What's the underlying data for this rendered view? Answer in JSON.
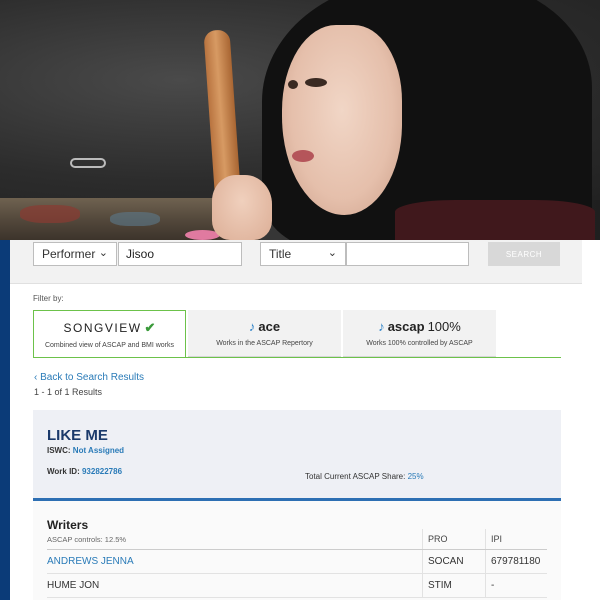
{
  "search": {
    "field_select": "Performer",
    "query_value": "Jisoo",
    "type_select": "Title",
    "secondary_value": "",
    "button_label": "SEARCH"
  },
  "filters": {
    "label": "Filter by:",
    "tabs": [
      {
        "logo_text": "SONGVIEW",
        "logo_mark": "✔",
        "description": "Combined view of ASCAP and BMI works",
        "active": true
      },
      {
        "logo_text": "ace",
        "logo_mark": "♪",
        "description": "Works in the ASCAP Repertory",
        "active": false
      },
      {
        "logo_text": "ascap",
        "logo_suffix": "100%",
        "logo_mark": "♪",
        "description": "Works 100% controlled by ASCAP",
        "active": false
      }
    ]
  },
  "nav": {
    "back_label": "Back to Search Results",
    "results_count": "1 - 1 of 1 Results"
  },
  "work": {
    "title": "LIKE ME",
    "iswc_label": "ISWC:",
    "iswc_value": "Not Assigned",
    "work_id_label": "Work ID:",
    "work_id_value": "932822786",
    "share_label": "Total Current ASCAP Share:",
    "share_value": "25%"
  },
  "writers": {
    "heading": "Writers",
    "controls": "ASCAP controls: 12.5%",
    "columns": {
      "pro": "PRO",
      "ipi": "IPI"
    },
    "rows": [
      {
        "name": "ANDREWS JENNA",
        "pro": "SOCAN",
        "ipi": "679781180",
        "linked": true
      },
      {
        "name": "HUME JON",
        "pro": "STIM",
        "ipi": "-",
        "linked": false
      }
    ]
  },
  "colors": {
    "brand_navy": "#0b3b78",
    "link_blue": "#2a7bb8",
    "active_green": "#6cc24a",
    "card_bg": "#eef0f5"
  }
}
